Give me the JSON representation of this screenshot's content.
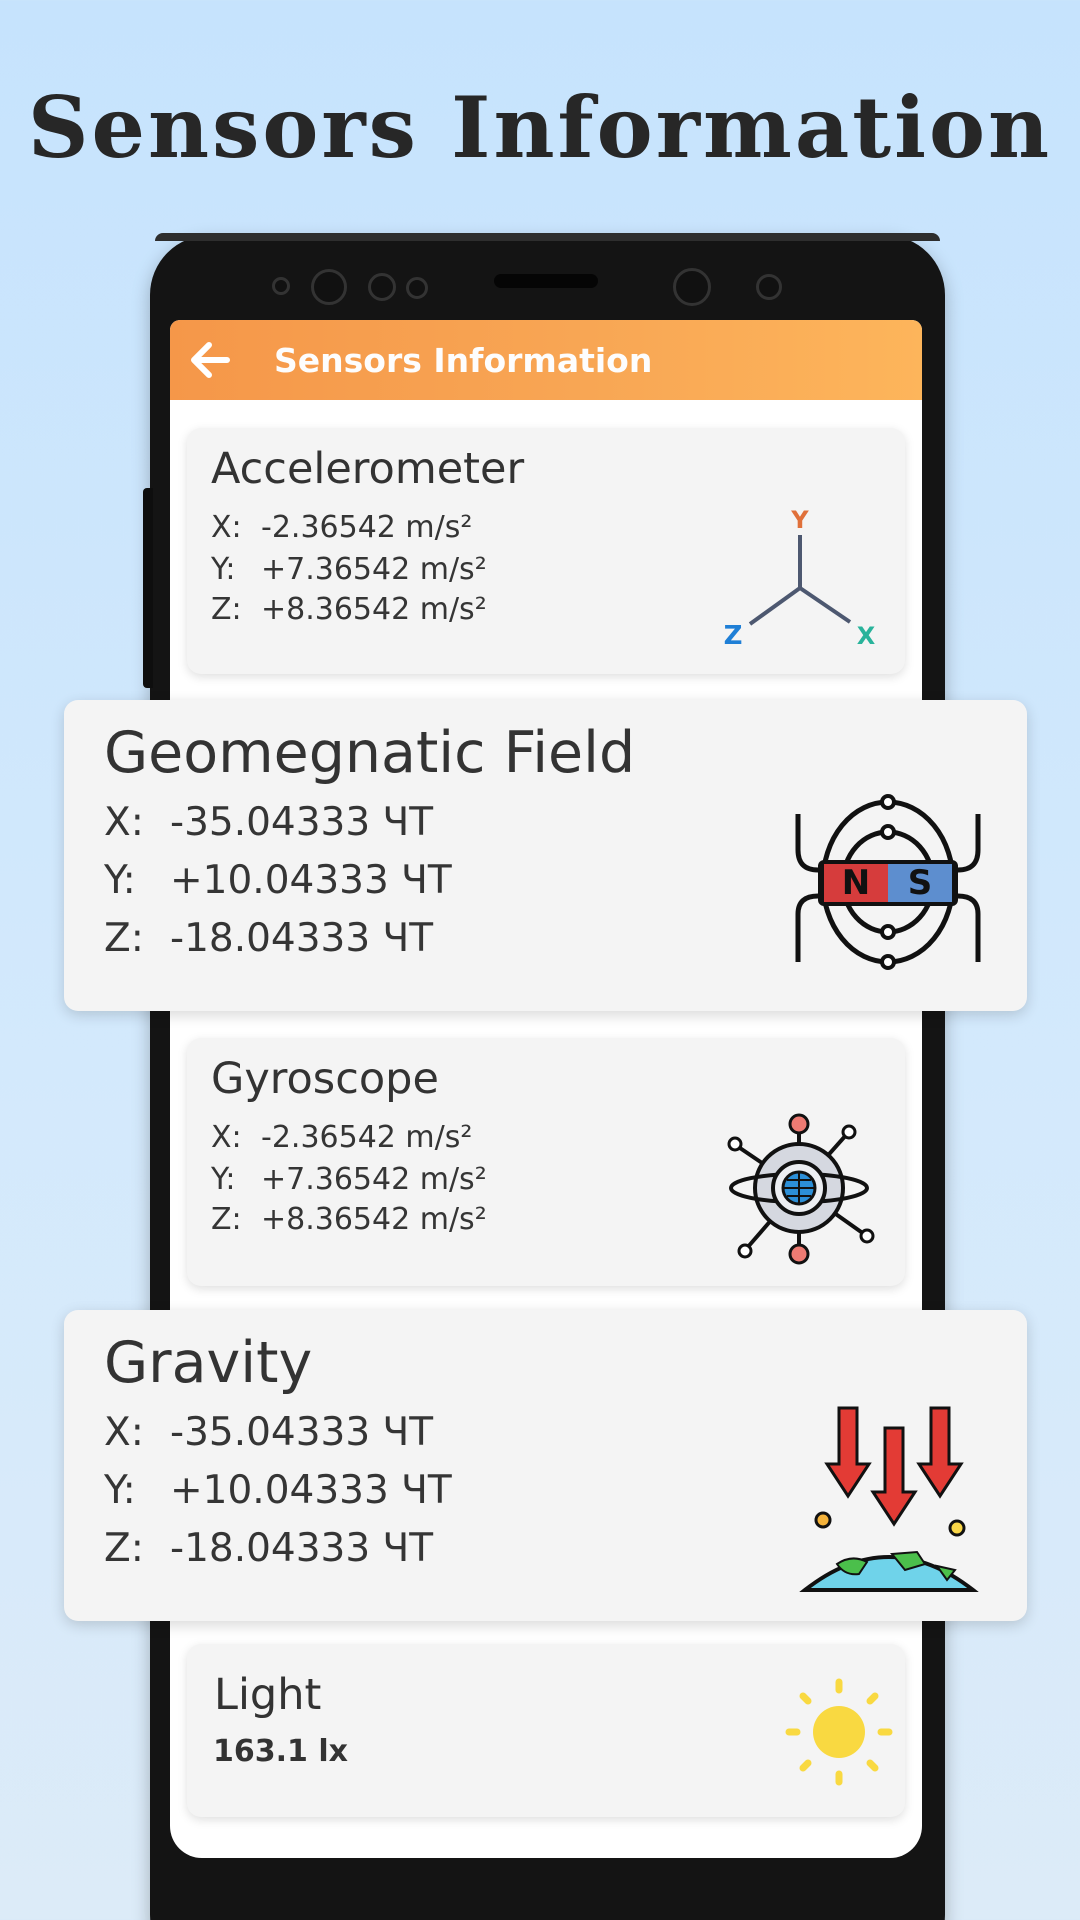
{
  "promo": {
    "title": "Sensors Information"
  },
  "app_bar": {
    "title": "Sensors Information",
    "back_icon": "back-arrow-icon"
  },
  "colors": {
    "app_bar_start": "#f59749",
    "app_bar_end": "#fdb55b",
    "background": "#c6e3fd",
    "card": "#f4f4f4",
    "text": "#333333"
  },
  "cards": {
    "accelerometer": {
      "title": "Accelerometer",
      "icon": "xyz-axes-icon",
      "readings": [
        {
          "axis": "X:",
          "value": " -2.36542 m/s²"
        },
        {
          "axis": "Y:",
          "value": "+7.36542 m/s²"
        },
        {
          "axis": "Z:",
          "value": "+8.36542 m/s²"
        }
      ],
      "axis_labels": {
        "x": "X",
        "y": "Y",
        "z": "Z"
      }
    },
    "geomagnetic": {
      "title": "Geomegnatic Field",
      "icon": "magnet-field-icon",
      "readings": [
        {
          "axis": "X:",
          "value": "-35.04333 ЧТ"
        },
        {
          "axis": "Y:",
          "value": "+10.04333 ЧТ"
        },
        {
          "axis": "Z:",
          "value": "-18.04333 ЧТ"
        }
      ],
      "magnet_labels": {
        "north": "N",
        "south": "S"
      }
    },
    "gyroscope": {
      "title": "Gyroscope",
      "icon": "gyroscope-icon",
      "readings": [
        {
          "axis": "X:",
          "value": " -2.36542 m/s²"
        },
        {
          "axis": "Y:",
          "value": "+7.36542 m/s²"
        },
        {
          "axis": "Z:",
          "value": "+8.36542 m/s²"
        }
      ]
    },
    "gravity": {
      "title": "Gravity",
      "icon": "gravity-earth-icon",
      "readings": [
        {
          "axis": "X:",
          "value": "-35.04333 ЧТ"
        },
        {
          "axis": "Y:",
          "value": "+10.04333 ЧТ"
        },
        {
          "axis": "Z:",
          "value": "-18.04333 ЧТ"
        }
      ]
    },
    "light": {
      "title": "Light",
      "icon": "sun-icon",
      "value": "163.1 lx"
    }
  }
}
